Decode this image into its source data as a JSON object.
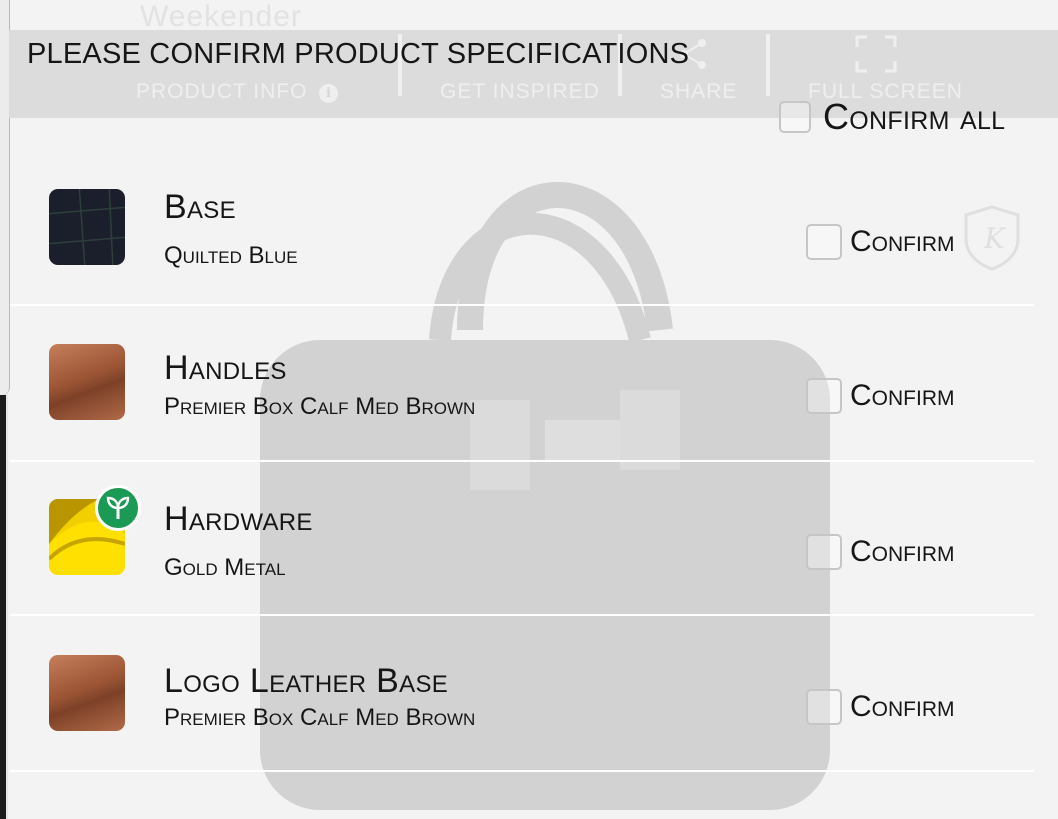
{
  "background": {
    "product_title": "Weekender",
    "nav": {
      "product_info": "PRODUCT INFO",
      "info_icon_glyph": "i",
      "get_inspired": "GET INSPIRED",
      "share": "SHARE",
      "full_screen": "FULL SCREEN"
    },
    "brand_mark": "K"
  },
  "dialog": {
    "title": "PLEASE CONFIRM PRODUCT SPECIFICATIONS",
    "confirm_all_label": "Confirm all",
    "items": [
      {
        "title": "Base",
        "subtitle": "Quilted Blue",
        "confirm_label": "Confirm",
        "swatch": "navy-quilted"
      },
      {
        "title": "Handles",
        "subtitle": "Premier Box Calf Med Brown",
        "confirm_label": "Confirm",
        "swatch": "brown-leather"
      },
      {
        "title": "Hardware",
        "subtitle": "Gold Metal",
        "confirm_label": "Confirm",
        "swatch": "gold-metal",
        "badge_icon": "eco-sprout-icon"
      },
      {
        "title": "Logo Leather Base",
        "subtitle": "Premier Box Calf Med Brown",
        "confirm_label": "Confirm",
        "swatch": "brown-leather"
      }
    ]
  },
  "colors": {
    "text": "#161616",
    "eco_badge": "#1a9a54",
    "gold": "#f2cf00",
    "navy": "#1b1f2b",
    "brown": "#9b5535"
  }
}
